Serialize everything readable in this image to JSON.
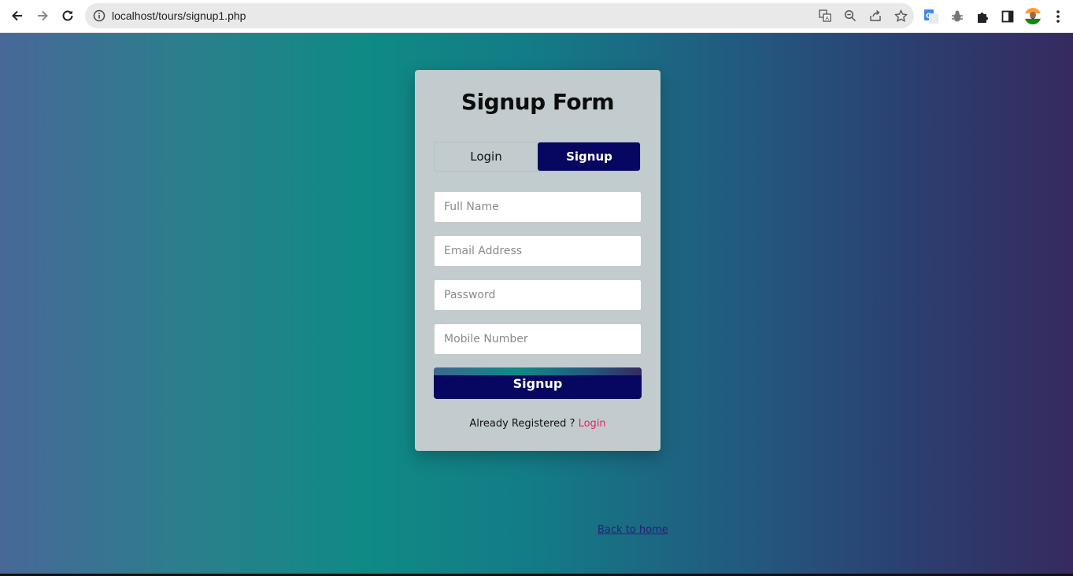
{
  "browser": {
    "url": "localhost/tours/signup1.php",
    "icons": [
      "back-icon",
      "forward-icon",
      "reload-icon",
      "info-icon",
      "translate-icon",
      "zoom-icon",
      "share-icon",
      "star-icon",
      "google-translate-icon",
      "bug-icon",
      "extensions-icon",
      "side-panel-icon",
      "avatar",
      "menu-icon"
    ]
  },
  "form": {
    "title": "Signup Form",
    "tabs": {
      "login": "Login",
      "signup": "Signup"
    },
    "fields": {
      "full_name": {
        "placeholder": "Full Name",
        "value": ""
      },
      "email": {
        "placeholder": "Email Address",
        "value": ""
      },
      "password": {
        "placeholder": "Password",
        "value": ""
      },
      "mobile": {
        "placeholder": "Mobile Number",
        "value": ""
      }
    },
    "submit_label": "Signup",
    "already_text": "Already Registered ?",
    "login_link": "Login"
  },
  "back_home": "Back to home",
  "colors": {
    "primary": "#070660",
    "link": "#e91e63",
    "card_bg": "#c2cccf"
  }
}
